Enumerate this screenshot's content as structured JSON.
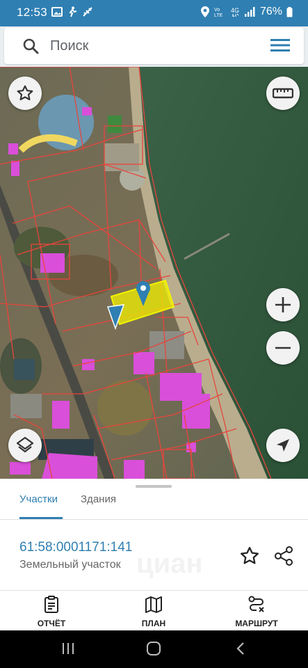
{
  "status_bar": {
    "time": "12:53",
    "battery": "76%"
  },
  "search": {
    "placeholder": "Поиск"
  },
  "sheet": {
    "tabs": [
      {
        "label": "Участки",
        "active": true
      },
      {
        "label": "Здания",
        "active": false
      }
    ],
    "parcel": {
      "cadastral_number": "61:58:0001171:141",
      "type": "Земельный участок"
    },
    "watermark": "циан"
  },
  "bottom_nav": {
    "items": [
      {
        "label": "ОТЧЁТ",
        "icon": "report-icon"
      },
      {
        "label": "ПЛАН",
        "icon": "map-plan-icon"
      },
      {
        "label": "МАРШРУТ",
        "icon": "route-icon"
      }
    ]
  },
  "colors": {
    "accent": "#2f7fb2",
    "selected_parcel": "#f2f200",
    "building_highlight": "#d94fd9",
    "parcel_border": "#e8453c",
    "sea": "#2f5a3e"
  }
}
